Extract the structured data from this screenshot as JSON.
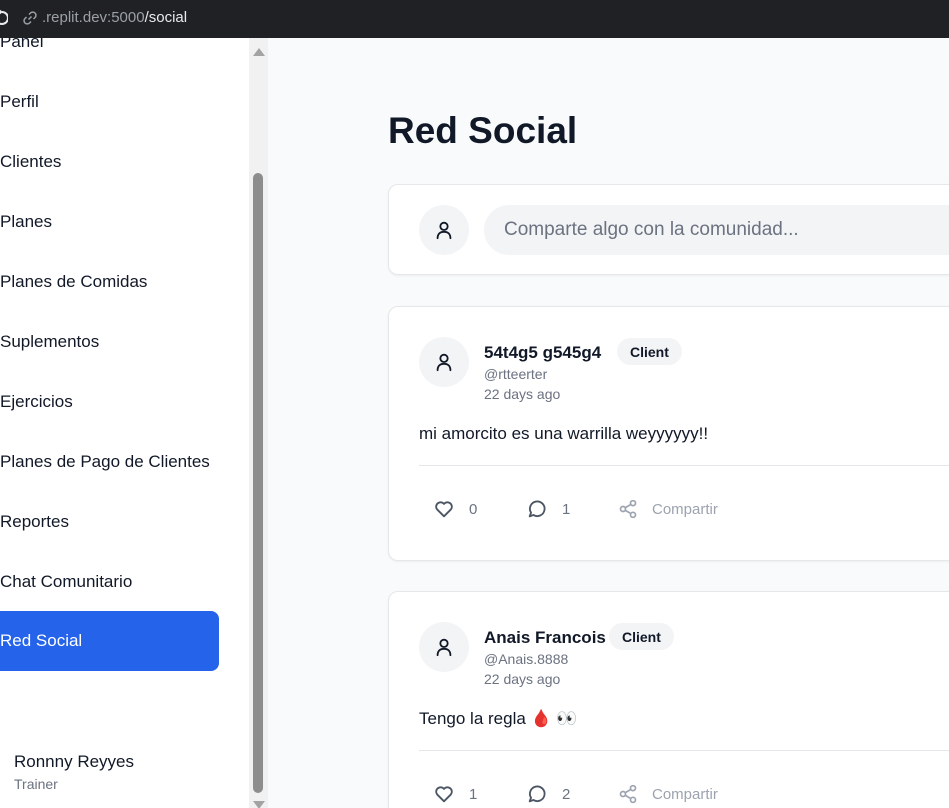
{
  "browser": {
    "url_host": ".replit.dev:5000",
    "url_path": "/social"
  },
  "sidebar": {
    "items": [
      {
        "label": "Panel",
        "active": false
      },
      {
        "label": "Perfil",
        "active": false
      },
      {
        "label": "Clientes",
        "active": false
      },
      {
        "label": "Planes",
        "active": false
      },
      {
        "label": "Planes de Comidas",
        "active": false
      },
      {
        "label": "Suplementos",
        "active": false
      },
      {
        "label": "Ejercicios",
        "active": false
      },
      {
        "label": "Planes de Pago de Clientes",
        "active": false
      },
      {
        "label": "Reportes",
        "active": false
      },
      {
        "label": "Chat Comunitario",
        "active": false
      },
      {
        "label": "Red Social",
        "active": true
      }
    ],
    "user": {
      "name": "Ronnny Reyyes",
      "role": "Trainer"
    }
  },
  "main": {
    "title": "Red Social",
    "composer": {
      "placeholder": "Comparte algo con la comunidad..."
    },
    "posts": [
      {
        "name": "54t4g5 g545g4",
        "badge": "Client",
        "handle": "@rtteerter",
        "time": "22 days ago",
        "body": "mi amorcito es una warrilla weyyyyyy!!",
        "likes": "0",
        "comments": "1",
        "share_label": "Compartir"
      },
      {
        "name": "Anais Francois",
        "badge": "Client",
        "handle": "@Anais.8888",
        "time": "22 days ago",
        "body": "Tengo la regla 🩸 👀",
        "likes": "1",
        "comments": "2",
        "share_label": "Compartir"
      }
    ]
  },
  "colors": {
    "accent": "#2563eb",
    "sidebar_bg": "#ffffff",
    "main_bg": "#f9fafb",
    "browser_bar": "#202124"
  }
}
